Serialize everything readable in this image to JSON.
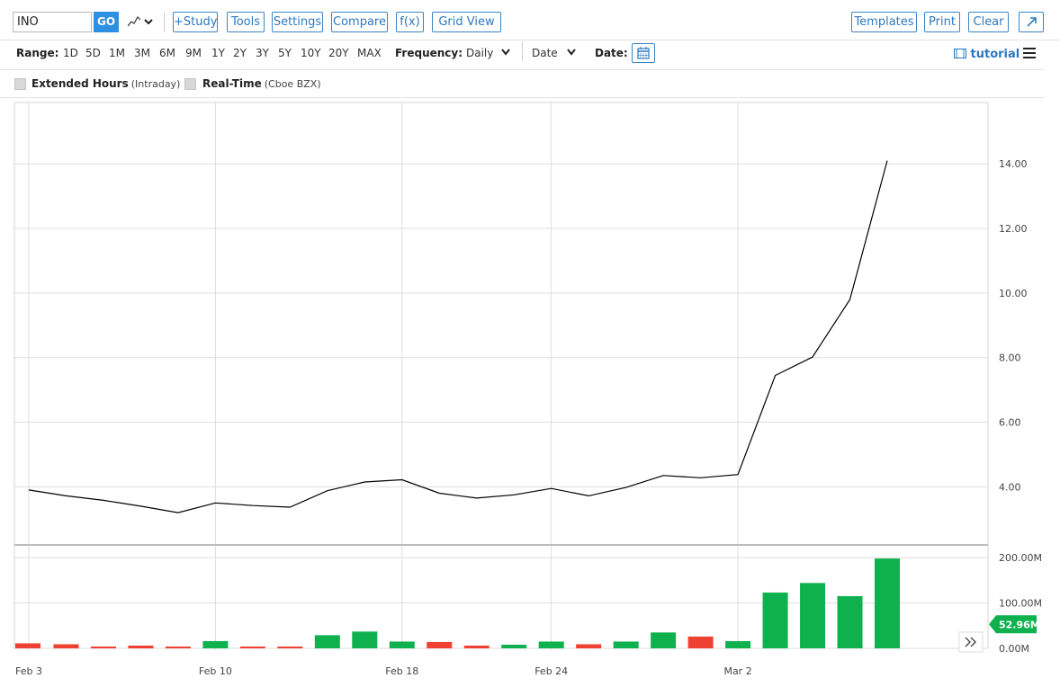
{
  "toolbar": {
    "symbol": "INO",
    "go_label": "GO",
    "study_label": "+Study",
    "tools_label": "Tools",
    "settings_label": "Settings",
    "compare_label": "Compare",
    "fx_label": "f(x)",
    "gridview_label": "Grid View",
    "templates_label": "Templates",
    "print_label": "Print",
    "clear_label": "Clear",
    "popout_icon": "external-link-icon",
    "charttype_icon": "line-chart-icon"
  },
  "rangebar": {
    "range_label": "Range:",
    "ranges": [
      "1D",
      "5D",
      "1M",
      "3M",
      "6M",
      "9M",
      "1Y",
      "2Y",
      "3Y",
      "5Y",
      "10Y",
      "20Y",
      "MAX"
    ],
    "frequency_label": "Frequency:",
    "frequency_value": "Daily",
    "date_select": "Date",
    "date_label": "Date:",
    "calendar_icon": "calendar-icon",
    "tutorial_label": "tutorial",
    "tutorial_icon": "film-icon",
    "menu_icon": "hamburger-menu-icon"
  },
  "options": {
    "extended_label": "Extended Hours",
    "extended_sub": "(Intraday)",
    "realtime_label": "Real-Time",
    "realtime_sub": "(Cboe BZX)"
  },
  "chart_data": [
    {
      "type": "line",
      "x": [
        "Feb 3",
        "Feb 4",
        "Feb 5",
        "Feb 6",
        "Feb 7",
        "Feb 10",
        "Feb 11",
        "Feb 12",
        "Feb 13",
        "Feb 14",
        "Feb 18",
        "Feb 19",
        "Feb 20",
        "Feb 21",
        "Feb 24",
        "Feb 25",
        "Feb 26",
        "Feb 27",
        "Feb 28",
        "Mar 2",
        "Mar 3",
        "Mar 4",
        "Mar 5",
        "Mar 6"
      ],
      "values": [
        3.9,
        3.72,
        3.58,
        3.4,
        3.2,
        3.5,
        3.42,
        3.37,
        3.88,
        4.15,
        4.22,
        3.8,
        3.65,
        3.75,
        3.95,
        3.72,
        3.98,
        4.35,
        4.28,
        4.38,
        7.45,
        8.02,
        9.8,
        14.1
      ],
      "x_tick_labels": [
        "Feb 3",
        "Feb 10",
        "Feb 18",
        "Feb 24",
        "Mar 2"
      ],
      "y_tick_labels": [
        "4.00",
        "6.00",
        "8.00",
        "10.00",
        "12.00",
        "14.00"
      ],
      "ylim": [
        2.2,
        15.9
      ],
      "line_color": "#000000",
      "grid": true
    },
    {
      "type": "bar",
      "x": [
        "Feb 3",
        "Feb 4",
        "Feb 5",
        "Feb 6",
        "Feb 7",
        "Feb 10",
        "Feb 11",
        "Feb 12",
        "Feb 13",
        "Feb 14",
        "Feb 18",
        "Feb 19",
        "Feb 20",
        "Feb 21",
        "Feb 24",
        "Feb 25",
        "Feb 26",
        "Feb 27",
        "Feb 28",
        "Mar 2",
        "Mar 3",
        "Mar 4",
        "Mar 5",
        "Mar 6"
      ],
      "values": [
        11,
        9,
        4,
        6,
        4,
        16,
        4,
        4,
        29,
        37,
        15,
        14,
        6,
        8,
        15,
        9,
        15,
        35,
        26,
        16,
        123,
        144,
        115,
        198
      ],
      "unit": "M",
      "directions": [
        "down",
        "down",
        "down",
        "down",
        "down",
        "up",
        "down",
        "down",
        "up",
        "up",
        "up",
        "down",
        "down",
        "up",
        "up",
        "down",
        "up",
        "up",
        "down",
        "up",
        "up",
        "up",
        "up",
        "up"
      ],
      "y_tick_labels": [
        "0.00M",
        "100.00M",
        "200.00M"
      ],
      "ylim": [
        0,
        220
      ],
      "last_value_label": "52.96M",
      "up_color": "#0fb14f",
      "down_color": "#ee4131",
      "scroll_icon": "double-chevron-right-icon"
    }
  ]
}
